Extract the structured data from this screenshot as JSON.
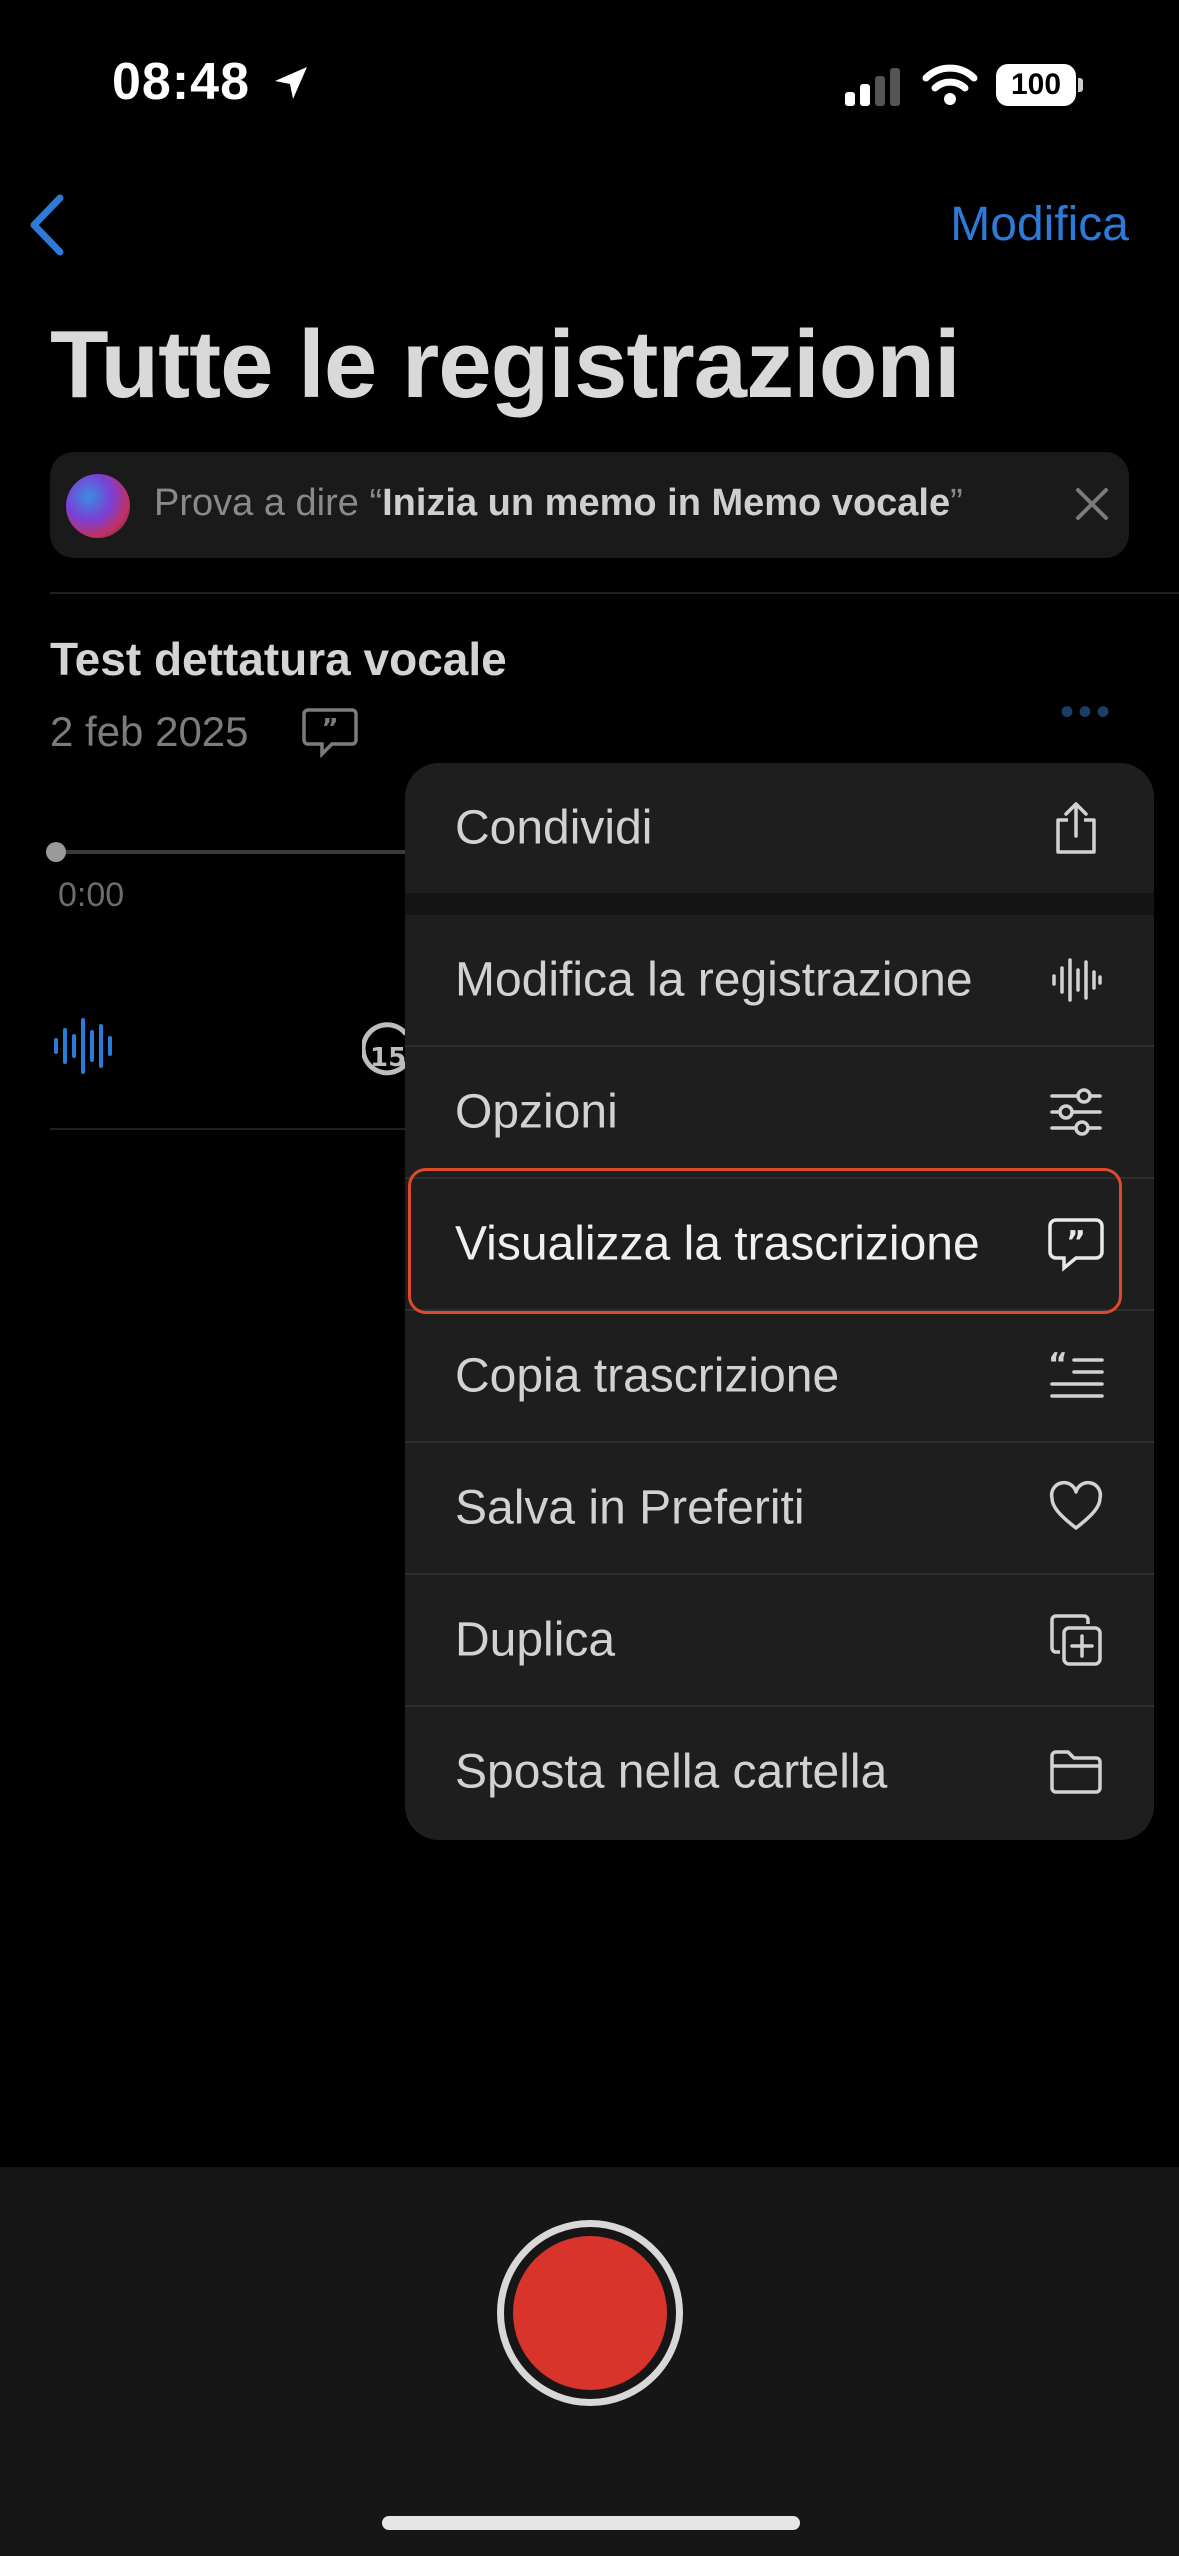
{
  "status_bar": {
    "time": "08:48",
    "battery": "100"
  },
  "nav": {
    "edit_label": "Modifica"
  },
  "page_title": "Tutte le registrazioni",
  "siri_banner": {
    "prefix": "Prova a dire “",
    "phrase": "Inizia un memo in Memo vocale",
    "suffix": "”"
  },
  "recording": {
    "title": "Test dettatura vocale",
    "date": "2 feb 2025",
    "elapsed": "0:00",
    "more_label": "•••"
  },
  "context_menu": {
    "items": [
      {
        "label": "Condividi",
        "icon": "share-icon"
      },
      {
        "label": "Modifica la registrazione",
        "icon": "waveform-icon"
      },
      {
        "label": "Opzioni",
        "icon": "sliders-icon"
      },
      {
        "label": "Visualizza la trascrizione",
        "icon": "quote-bubble-icon"
      },
      {
        "label": "Copia trascrizione",
        "icon": "copy-transcript-icon"
      },
      {
        "label": "Salva in Preferiti",
        "icon": "heart-icon"
      },
      {
        "label": "Duplica",
        "icon": "duplicate-icon"
      },
      {
        "label": "Sposta nella cartella",
        "icon": "folder-icon"
      }
    ],
    "highlighted_item": "Visualizza la trascrizione"
  },
  "colors": {
    "accent": "#2d7bd8",
    "record": "#d8342b",
    "highlight_border": "#e0492b",
    "menu_bg": "#1e1e1e"
  }
}
